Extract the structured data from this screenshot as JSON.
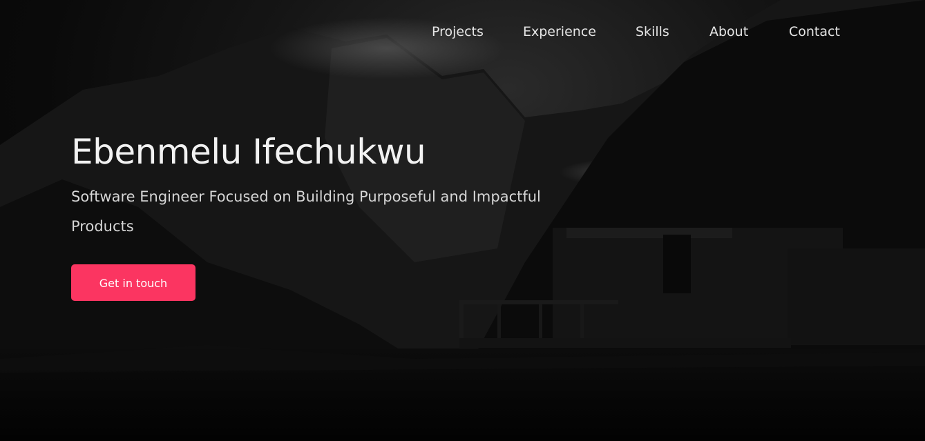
{
  "nav": {
    "items": [
      {
        "label": "Projects"
      },
      {
        "label": "Experience"
      },
      {
        "label": "Skills"
      },
      {
        "label": "About"
      },
      {
        "label": "Contact"
      }
    ]
  },
  "hero": {
    "name": "Ebenmelu Ifechukwu",
    "tagline": "Software Engineer Focused on Building Purposeful and Impactful Products",
    "cta_label": "Get in touch",
    "background_image": "dark-mountain-lake-cabin-photo"
  },
  "colors": {
    "accent": "#fb3561",
    "background": "#050505",
    "text": "#f2f2f2"
  }
}
